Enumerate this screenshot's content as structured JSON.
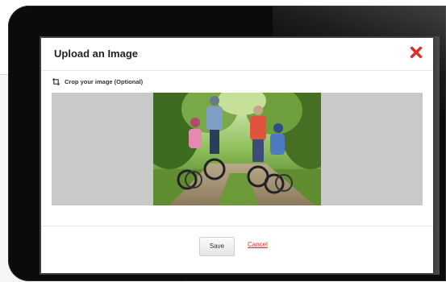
{
  "modal": {
    "title": "Upload an Image",
    "close_icon": "close-x-icon",
    "crop_label": "Crop your image (Optional)",
    "crop_icon": "crop-icon",
    "save_label": "Save",
    "cancel_label": "Cancel"
  },
  "colors": {
    "close_icon": "#d9322b",
    "cancel_link": "#d2302f",
    "crop_area_bg": "#c9c9c9"
  }
}
